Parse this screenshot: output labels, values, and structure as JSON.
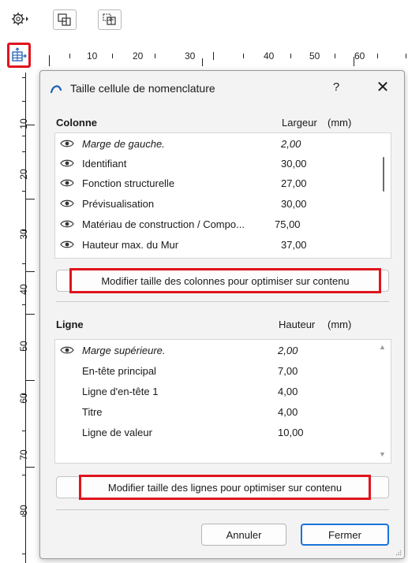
{
  "toolbar": {
    "settings_icon": "gear-icon",
    "btn1_icon": "frame-select-icon",
    "btn2_icon": "marquee-select-icon",
    "side_button_icon": "table-insert-icon"
  },
  "ruler": {
    "h_labels": [
      "10",
      "20",
      "30",
      "40",
      "50",
      "60"
    ],
    "v_labels": [
      "10",
      "20",
      "30",
      "40",
      "50",
      "60",
      "70",
      "80"
    ]
  },
  "dialog": {
    "title": "Taille cellule de nomenclature",
    "help": "?",
    "close": "✕",
    "columns": {
      "header": "Colonne",
      "width_header": "Largeur",
      "unit": "(mm)",
      "rows": [
        {
          "label": "Marge de gauche.",
          "value": "2,00",
          "italic": true
        },
        {
          "label": "Identifiant",
          "value": "30,00",
          "italic": false
        },
        {
          "label": "Fonction structurelle",
          "value": "27,00",
          "italic": false
        },
        {
          "label": "Prévisualisation",
          "value": "30,00",
          "italic": false
        },
        {
          "label": "Matériau de construction / Compo...",
          "value": "75,00",
          "italic": false
        },
        {
          "label": "Hauteur max. du Mur",
          "value": "37,00",
          "italic": false
        }
      ],
      "optimize_button": "Modifier taille des colonnes pour optimiser sur contenu"
    },
    "lines": {
      "header": "Ligne",
      "height_header": "Hauteur",
      "unit": "(mm)",
      "rows": [
        {
          "label": "Marge supérieure.",
          "value": "2,00",
          "italic": true,
          "eye": true
        },
        {
          "label": "En-tête principal",
          "value": "7,00",
          "italic": false,
          "eye": false
        },
        {
          "label": "Ligne d'en-tête 1",
          "value": "4,00",
          "italic": false,
          "eye": false
        },
        {
          "label": "Titre",
          "value": "4,00",
          "italic": false,
          "eye": false
        },
        {
          "label": "Ligne de valeur",
          "value": "10,00",
          "italic": false,
          "eye": false
        }
      ],
      "optimize_button": "Modifier taille des lignes pour optimiser sur contenu"
    },
    "cancel": "Annuler",
    "ok": "Fermer"
  },
  "colors": {
    "highlight": "#e0141c",
    "accent": "#1a73d9"
  }
}
